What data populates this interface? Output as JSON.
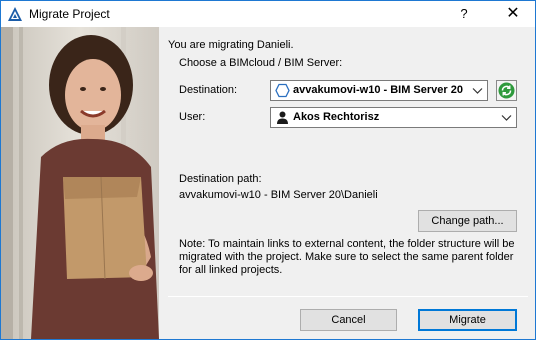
{
  "window": {
    "title": "Migrate Project",
    "help_label": "?",
    "close_label": "✕"
  },
  "content": {
    "intro": "You are migrating Danieli.",
    "choose_server": "Choose a BIMcloud / BIM Server:",
    "destination_label": "Destination:",
    "destination_value": "avvakumovi-w10 - BIM Server 20",
    "user_label": "User:",
    "user_value": "Akos Rechtorisz",
    "destination_path_label": "Destination path:",
    "destination_path_value": "avvakumovi-w10 - BIM Server 20\\Danieli",
    "change_path_button": "Change path...",
    "note": "Note: To maintain links to external content, the folder structure will be migrated with the project. Make sure to select the same parent folder for all linked projects."
  },
  "buttons": {
    "cancel": "Cancel",
    "migrate": "Migrate"
  },
  "icons": {
    "app": "archicad-icon",
    "server": "server-hexagon-icon",
    "user": "user-icon",
    "refresh": "refresh-icon",
    "dropdown": "chevron-down-icon"
  },
  "colors": {
    "window_border": "#1e78d2",
    "refresh_green": "#2e9a3c",
    "default_button_border": "#0078d7"
  }
}
